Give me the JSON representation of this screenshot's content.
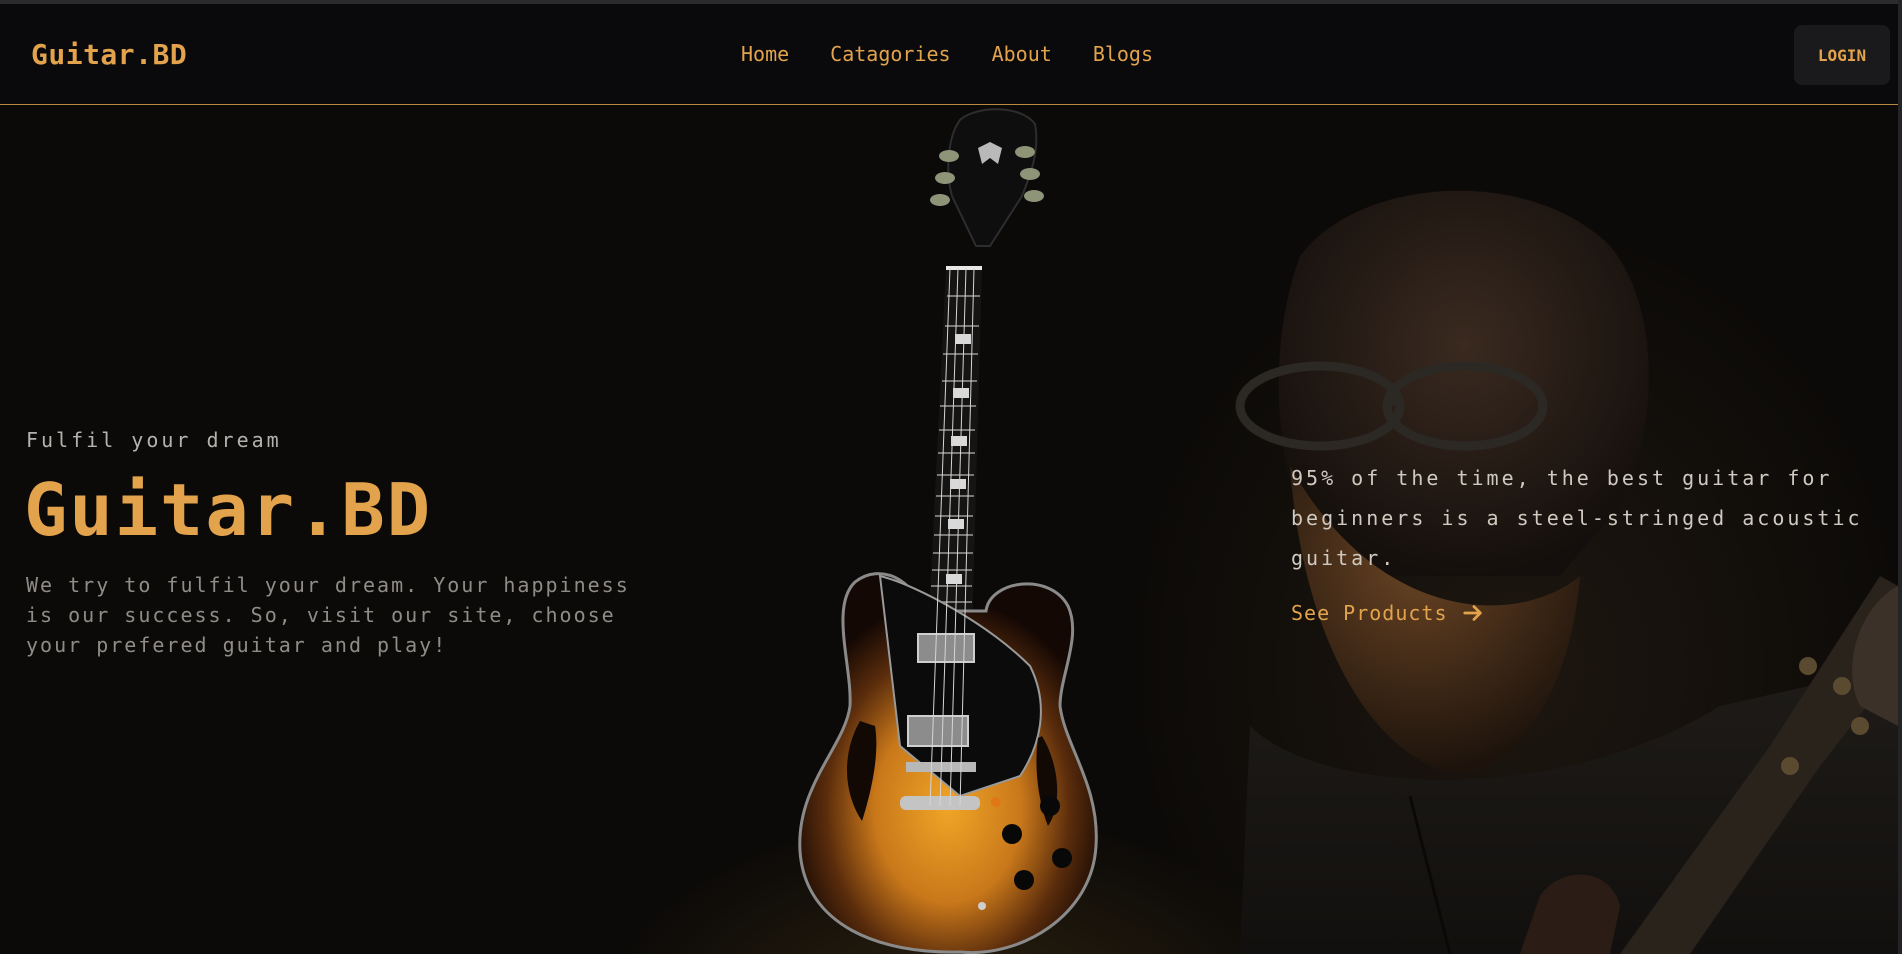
{
  "header": {
    "brand": "Guitar.BD",
    "nav": [
      {
        "label": "Home"
      },
      {
        "label": "Catagories"
      },
      {
        "label": "About"
      },
      {
        "label": "Blogs"
      }
    ],
    "login_label": "LOGIN"
  },
  "hero": {
    "eyebrow": "Fulfil your dream",
    "title": "Guitar.BD",
    "description": "We try to fulfil your dream. Your happiness is our success. So, visit our site, choose your prefered guitar and play!",
    "fact": "95% of the time, the best guitar for beginners is a steel-stringed acoustic guitar.",
    "cta_label": "See Products",
    "cta_icon": "arrow-right-icon"
  },
  "colors": {
    "accent": "#e2a34c",
    "background": "#0c0a08",
    "navbar": "#0a0a0c",
    "muted_text": "#8f8c88"
  }
}
